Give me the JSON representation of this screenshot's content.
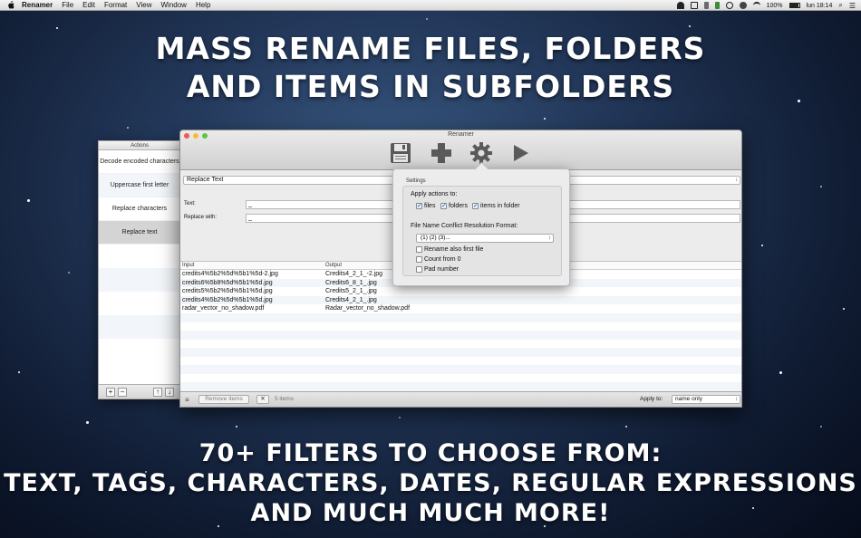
{
  "menubar": {
    "app_name": "Renamer",
    "items": [
      "File",
      "Edit",
      "Format",
      "View",
      "Window",
      "Help"
    ],
    "battery": "100%",
    "clock": "lun 18:14"
  },
  "headline_top": {
    "line1": "MASS RENAME FILES, FOLDERS",
    "line2": "AND ITEMS IN SUBFOLDERS"
  },
  "headline_bottom": {
    "line1": "70+ FILTERS TO CHOOSE FROM:",
    "line2": "TEXT, TAGS, CHARACTERS, DATES, REGULAR EXPRESSIONS",
    "line3": "AND MUCH MUCH MORE!"
  },
  "actions_panel": {
    "header": "Actions",
    "items": [
      "Decode encoded characters",
      "Uppercase first letter",
      "Replace characters",
      "Replace text"
    ],
    "selected_index": 3,
    "add_label": "+",
    "remove_label": "−",
    "up_label": "↑",
    "down_label": "↓"
  },
  "window": {
    "title": "Renamer",
    "toolbar": [
      "save-icon",
      "add-icon",
      "settings-icon",
      "run-icon"
    ],
    "filter_select": "Replace Text",
    "text_label": "Text:",
    "text_value": "_",
    "replace_label": "Replace with:",
    "replace_value": "_",
    "table": {
      "columns": [
        "Input",
        "Output"
      ],
      "rows": [
        [
          "credits4%5b2%5d%5b1%5d-2.jpg",
          "Credits4_2_1_-2.jpg"
        ],
        [
          "credits6%5b8%5d%5b1%5d.jpg",
          "Credits6_8_1_.jpg"
        ],
        [
          "credits5%5b2%5d%5b1%5d.jpg",
          "Credits5_2_1_.jpg"
        ],
        [
          "credits4%5b2%5d%5b1%5d.jpg",
          "Credits4_2_1_.jpg"
        ],
        [
          "radar_vector_no_shadow.pdf",
          "Radar_vector_no_shadow.pdf"
        ]
      ]
    },
    "bottom": {
      "menu_icon": "list-icon",
      "remove_label": "Remove items",
      "clear_label": "✕",
      "count": "5 items",
      "apply_label": "Apply to:",
      "apply_value": "name only"
    }
  },
  "settings": {
    "title": "Settings",
    "apply_actions_label": "Apply actions to:",
    "targets": [
      {
        "label": "files",
        "checked": true
      },
      {
        "label": "folders",
        "checked": true
      },
      {
        "label": "items in folder",
        "checked": true
      }
    ],
    "conflict_label": "File Name Conflict Resolution Format:",
    "conflict_value": "(1) (2) (3)...",
    "options": [
      {
        "label": "Rename also first file",
        "checked": false
      },
      {
        "label": "Count from 0",
        "checked": false
      },
      {
        "label": "Pad number",
        "checked": false
      }
    ]
  }
}
